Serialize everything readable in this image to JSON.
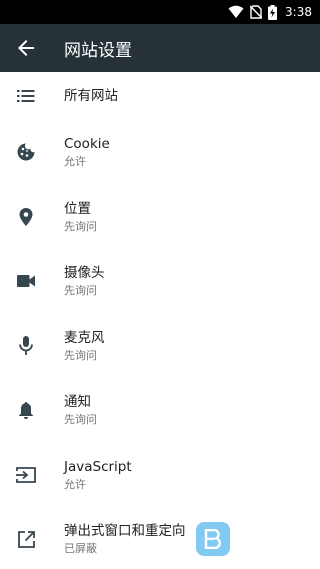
{
  "status_bar": {
    "time": "3:38",
    "icons": [
      "wifi-icon",
      "no-sim-icon",
      "battery-charging-icon"
    ]
  },
  "app_bar": {
    "back_icon": "arrow-back-icon",
    "title": "网站设置"
  },
  "settings": {
    "all_sites": {
      "icon": "list-icon",
      "label": "所有网站"
    },
    "items": [
      {
        "icon": "cookie-icon",
        "label": "Cookie",
        "value": "允许"
      },
      {
        "icon": "location-pin-icon",
        "label": "位置",
        "value": "先询问"
      },
      {
        "icon": "videocam-icon",
        "label": "摄像头",
        "value": "先询问"
      },
      {
        "icon": "mic-icon",
        "label": "麦克风",
        "value": "先询问"
      },
      {
        "icon": "bell-icon",
        "label": "通知",
        "value": "先询问"
      },
      {
        "icon": "input-icon",
        "label": "JavaScript",
        "value": "允许"
      },
      {
        "icon": "open-in-new-icon",
        "label": "弹出式窗口和重定向",
        "value": "已屏蔽"
      }
    ]
  },
  "colors": {
    "status_bar": "#000000",
    "app_bar": "#263238",
    "icon": "#37474f",
    "primary_text": "#212121",
    "secondary_text": "#757575"
  }
}
